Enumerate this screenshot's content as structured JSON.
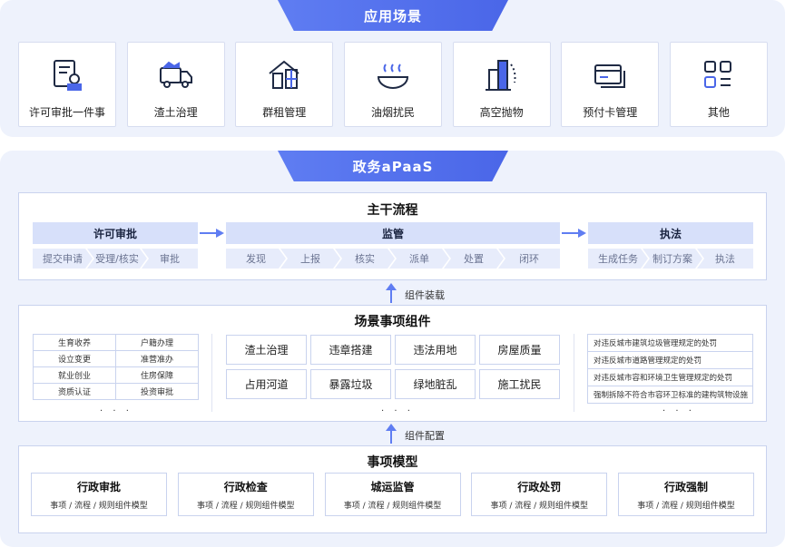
{
  "top": {
    "title": "应用场景",
    "scenes": [
      {
        "label": "许可审批一件事",
        "icon": "document-seal-icon"
      },
      {
        "label": "渣土治理",
        "icon": "dump-truck-icon"
      },
      {
        "label": "群租管理",
        "icon": "house-icon"
      },
      {
        "label": "油烟扰民",
        "icon": "cooking-pot-icon"
      },
      {
        "label": "高空抛物",
        "icon": "tall-building-icon"
      },
      {
        "label": "预付卡管理",
        "icon": "card-icon"
      },
      {
        "label": "其他",
        "icon": "grid-apps-icon"
      }
    ]
  },
  "platform": {
    "title": "政务aPaaS",
    "main_flow": {
      "title": "主干流程",
      "groups": [
        {
          "title": "许可审批",
          "steps": [
            "提交申请",
            "受理/核实",
            "审批"
          ]
        },
        {
          "title": "监管",
          "steps": [
            "发现",
            "上报",
            "核实",
            "派单",
            "处置",
            "闭环"
          ]
        },
        {
          "title": "执法",
          "steps": [
            "生成任务",
            "制订方案",
            "执法"
          ]
        }
      ]
    },
    "assembly_label": "组件装载",
    "components": {
      "title": "场景事项组件",
      "left_table": [
        [
          "生育收养",
          "户籍办理"
        ],
        [
          "设立变更",
          "准营准办"
        ],
        [
          "就业创业",
          "住房保障"
        ],
        [
          "资质认证",
          "投资审批"
        ]
      ],
      "middle_grid": [
        "渣土治理",
        "违章搭建",
        "违法用地",
        "房屋质量",
        "占用河道",
        "暴露垃圾",
        "绿地脏乱",
        "施工扰民"
      ],
      "rules": [
        "对违反城市建筑垃圾管理规定的处罚",
        "对违反城市道路管理规定的处罚",
        "对违反城市容和环境卫生管理规定的处罚",
        "强制拆除不符合市容环卫标准的建构筑物设施"
      ],
      "ellipsis": "· · ·"
    },
    "config_label": "组件配置",
    "model": {
      "title": "事项模型",
      "cards": [
        {
          "title": "行政审批",
          "sub": "事项 / 流程 / 规则组件模型"
        },
        {
          "title": "行政检查",
          "sub": "事项 / 流程 / 规则组件模型"
        },
        {
          "title": "城运监管",
          "sub": "事项 / 流程 / 规则组件模型"
        },
        {
          "title": "行政处罚",
          "sub": "事项 / 流程 / 规则组件模型"
        },
        {
          "title": "行政强制",
          "sub": "事项 / 流程 / 规则组件模型"
        }
      ]
    }
  },
  "colors": {
    "accent": "#4a66e8",
    "panel": "#eef2fc",
    "head": "#d7e0fa",
    "step": "#e7ecfb",
    "border": "#c9d3ee"
  }
}
